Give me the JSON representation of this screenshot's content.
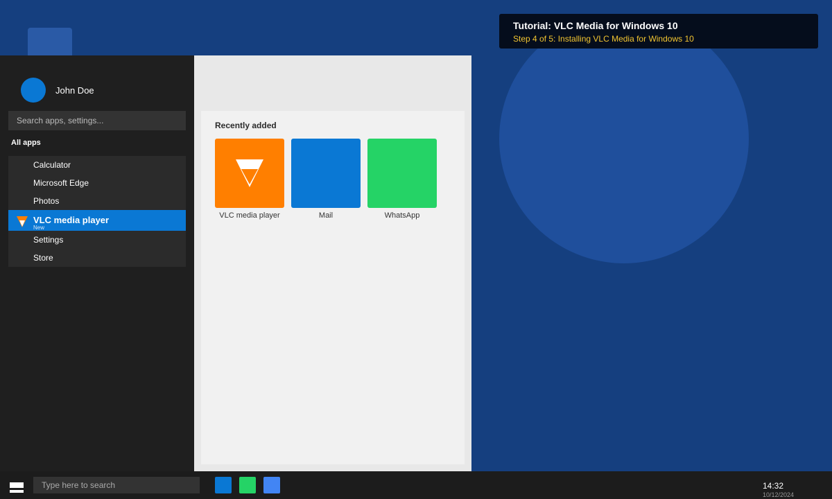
{
  "tutorial": {
    "title": "Tutorial: VLC Media for Windows 10",
    "step": "Step 4 of 5: Installing VLC Media for Windows 10"
  },
  "start_menu": {
    "user_name": "John Doe",
    "search_placeholder": "Search apps, settings...",
    "all_apps_label": "All apps",
    "apps": [
      {
        "label": "Calculator"
      },
      {
        "label": "Microsoft Edge"
      },
      {
        "label": "Photos"
      },
      {
        "label": "VLC media player",
        "badge": "New",
        "selected": true
      },
      {
        "label": "Settings"
      },
      {
        "label": "Store"
      }
    ],
    "recently_added": {
      "title": "Recently added",
      "tiles": [
        {
          "label": "VLC media player",
          "color": "#ff7f00"
        },
        {
          "label": "Mail",
          "color": "#0a78d4"
        },
        {
          "label": "WhatsApp",
          "color": "#25d366"
        }
      ]
    }
  },
  "taskbar": {
    "search_placeholder": "Type here to search",
    "pinned_colors": [
      "#0a78d4",
      "#25d366",
      "#4285f4"
    ],
    "time": "14:32",
    "date": "10/12/2024"
  },
  "colors": {
    "desktop": "#153f7f",
    "accent": "#0a78d4",
    "vlc_orange": "#ff7f00",
    "tutorial_step": "#f2c531"
  }
}
